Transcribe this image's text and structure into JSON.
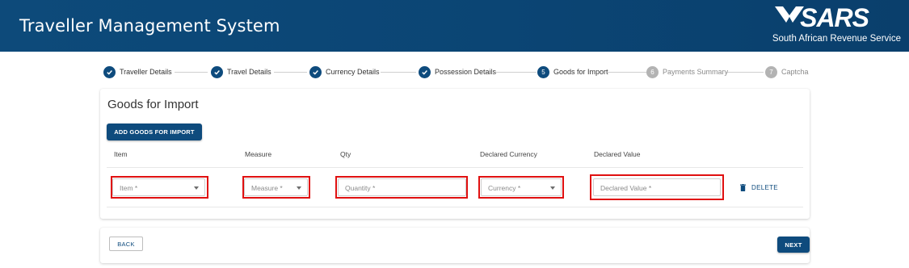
{
  "header": {
    "title": "Traveller Management System",
    "logo_text": "SARS",
    "logo_subtitle": "South African Revenue Service"
  },
  "stepper": {
    "steps": [
      {
        "number": "1",
        "label": "Traveller Details",
        "status": "completed"
      },
      {
        "number": "2",
        "label": "Travel Details",
        "status": "completed"
      },
      {
        "number": "3",
        "label": "Currency Details",
        "status": "completed"
      },
      {
        "number": "4",
        "label": "Possession Details",
        "status": "completed"
      },
      {
        "number": "5",
        "label": "Goods for Import",
        "status": "active"
      },
      {
        "number": "6",
        "label": "Payments Summary",
        "status": "pending"
      },
      {
        "number": "7",
        "label": "Captcha",
        "status": "pending"
      }
    ]
  },
  "goods": {
    "title": "Goods for Import",
    "add_button_label": "ADD GOODS FOR IMPORT",
    "columns": [
      "Item",
      "Measure",
      "Qty",
      "Declared Currency",
      "Declared Value"
    ],
    "row": {
      "item_placeholder": "Item *",
      "measure_placeholder": "Measure *",
      "quantity_placeholder": "Quantity *",
      "currency_placeholder": "Currency *",
      "declared_value_placeholder": "Declared Value *",
      "delete_label": "DELETE"
    }
  },
  "navigation": {
    "back_label": "BACK",
    "next_label": "NEXT"
  },
  "colors": {
    "brand": "#0e4b7d",
    "header_bg": "#0d4a7a",
    "highlight": "#e01010",
    "pending": "#b3b3b3"
  },
  "icons": {
    "completed_step": "check-circle-icon",
    "dropdown": "caret-down-icon",
    "delete": "trash-icon"
  }
}
